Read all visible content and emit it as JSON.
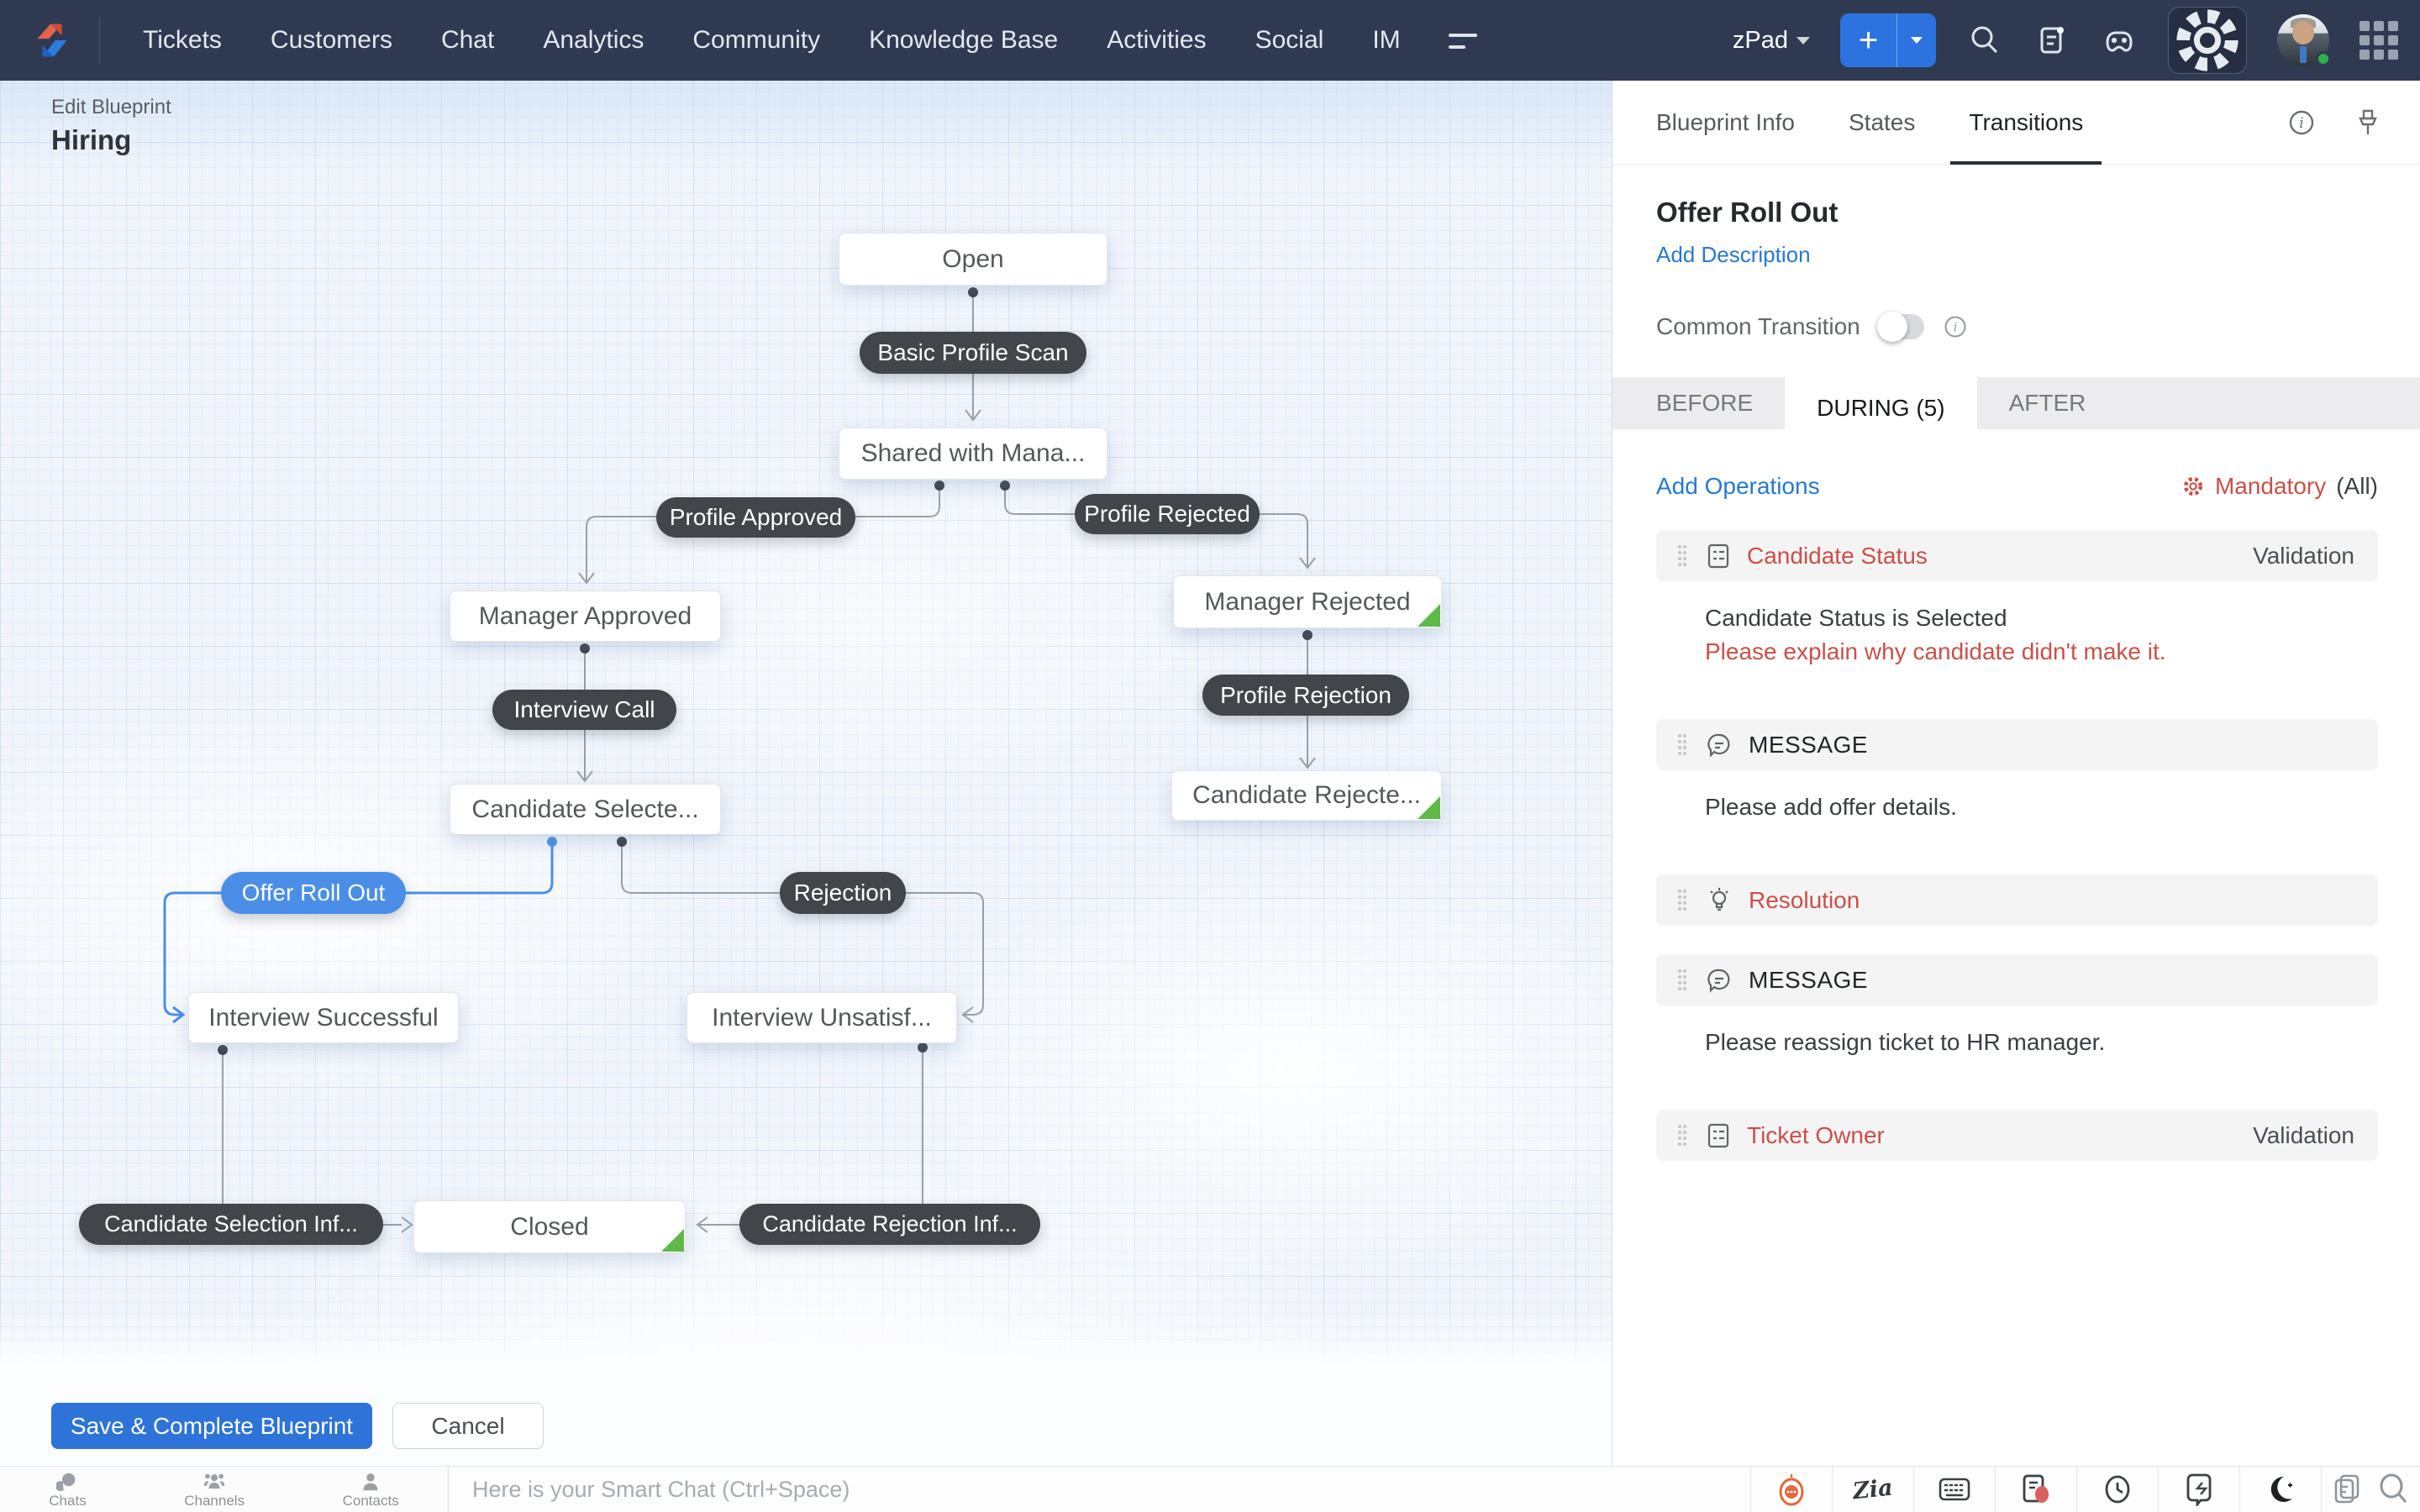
{
  "colors": {
    "accent": "#2e73d8",
    "nav_bg": "#2f3a52",
    "red": "#cb4f49",
    "green": "#5eb949",
    "pill_dark": "#424549",
    "pill_blue": "#4a8ee8",
    "link_blue": "#2679d0"
  },
  "nav": {
    "items": [
      "Tickets",
      "Customers",
      "Chat",
      "Analytics",
      "Community",
      "Knowledge Base",
      "Activities",
      "Social",
      "IM"
    ],
    "portal": "zPad",
    "plus_label": "+",
    "icons": [
      "search-icon",
      "feeds-icon",
      "games-icon",
      "settings-gear-icon",
      "apps-grid-icon"
    ]
  },
  "blueprint": {
    "breadcrumb": "Edit Blueprint",
    "title": "Hiring"
  },
  "flow": {
    "states": [
      {
        "label": "Open"
      },
      {
        "label": "Shared with Mana..."
      },
      {
        "label": "Manager Approved"
      },
      {
        "label": "Manager Rejected"
      },
      {
        "label": "Candidate Selecte..."
      },
      {
        "label": "Candidate Rejecte..."
      },
      {
        "label": "Interview Successful"
      },
      {
        "label": "Interview Unsatisf..."
      },
      {
        "label": "Closed"
      }
    ],
    "transitions": [
      {
        "label": "Basic Profile Scan"
      },
      {
        "label": "Profile Approved"
      },
      {
        "label": "Profile Rejected"
      },
      {
        "label": "Interview Call"
      },
      {
        "label": "Profile Rejection"
      },
      {
        "label": "Offer Roll Out",
        "highlight": true
      },
      {
        "label": "Rejection"
      },
      {
        "label": "Candidate Selection Inf..."
      },
      {
        "label": "Candidate Rejection Inf..."
      }
    ]
  },
  "panel": {
    "tabs": [
      "Blueprint Info",
      "States",
      "Transitions"
    ],
    "active_tab": "Transitions",
    "title": "Offer Roll Out",
    "add_description": "Add Description",
    "common_transition": "Common Transition",
    "stage_tabs": [
      "BEFORE",
      "DURING (5)",
      "AFTER"
    ],
    "active_stage": "DURING (5)",
    "add_operations": "Add Operations",
    "mandatory": "Mandatory",
    "mandatory_scope": "(All)",
    "operations": [
      {
        "title": "Candidate Status",
        "type": "Validation",
        "line1": "Candidate Status is Selected",
        "line2": "Please explain why candidate didn't make it."
      },
      {
        "title": "MESSAGE",
        "line1": "Please add offer details."
      },
      {
        "title": "Resolution"
      },
      {
        "title": "MESSAGE",
        "line1": "Please reassign ticket to HR manager."
      },
      {
        "title": "Ticket Owner",
        "type": "Validation"
      }
    ]
  },
  "footer": {
    "save": "Save & Complete Blueprint",
    "cancel": "Cancel"
  },
  "chatbar": {
    "tabs": [
      "Chats",
      "Channels",
      "Contacts"
    ],
    "placeholder": "Here is your Smart Chat (Ctrl+Space)",
    "zia_text": "Zia",
    "right_icons": [
      "bot-icon",
      "zia-icon",
      "keyboard-icon",
      "notes-icon",
      "clock-icon",
      "recent-icon",
      "night-mode-icon",
      "copy-icon",
      "search-icon"
    ]
  }
}
